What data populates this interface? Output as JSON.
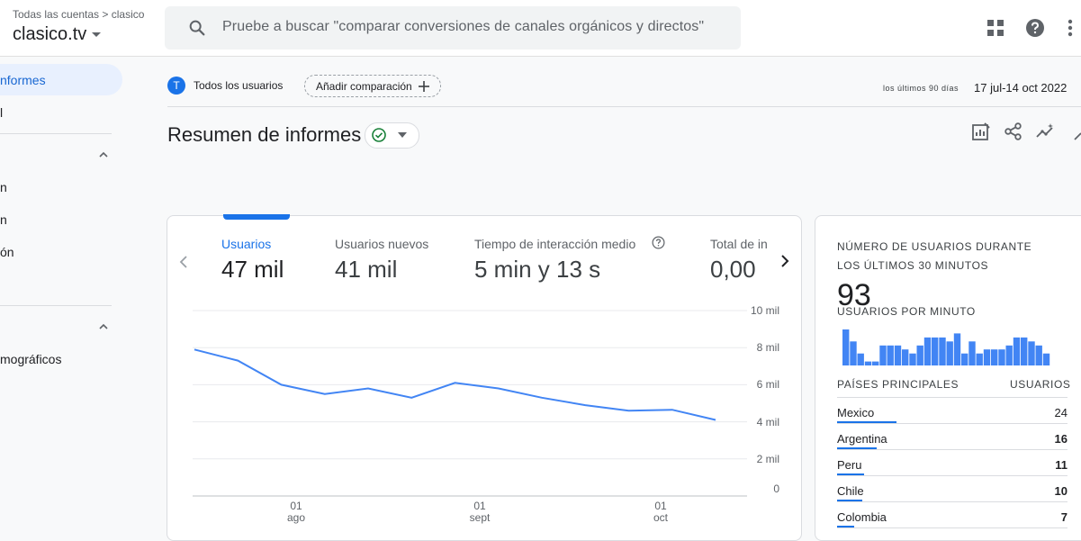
{
  "header": {
    "breadcrumb": "Todas las cuentas > clasico",
    "account": "clasico.tv",
    "search_placeholder": "Pruebe a buscar \"comparar conversiones de canales orgánicos y directos\""
  },
  "sidebar": {
    "items": [
      {
        "label": "nformes"
      },
      {
        "label": "l"
      },
      {
        "label": "n"
      },
      {
        "label": "n"
      },
      {
        "label": "ón"
      },
      {
        "label": "mográficos"
      }
    ]
  },
  "filters": {
    "user_avatar": "T",
    "user_label": "Todos los usuarios",
    "add_comparison": "Añadir comparación",
    "range_small": "los últimos 90 días",
    "range_dates": "17 jul-14 oct 2022"
  },
  "page": {
    "title": "Resumen de informes"
  },
  "metrics": [
    {
      "label": "Usuarios",
      "value": "47 mil"
    },
    {
      "label": "Usuarios nuevos",
      "value": "41 mil"
    },
    {
      "label": "Tiempo de interacción medio",
      "value": "5 min y 13 s"
    },
    {
      "label": "Total de in",
      "value": "0,00"
    }
  ],
  "chart_data": {
    "type": "line",
    "y_ticks": [
      "10 mil",
      "8 mil",
      "6 mil",
      "4 mil",
      "2 mil",
      "0"
    ],
    "x_ticks": [
      {
        "day": "01",
        "month": "ago"
      },
      {
        "day": "01",
        "month": "sept"
      },
      {
        "day": "01",
        "month": "oct"
      }
    ],
    "ylim": [
      0,
      10000
    ],
    "series": [
      {
        "values": [
          7900,
          7300,
          6000,
          5500,
          5800,
          5300,
          6100,
          5800,
          5300,
          4900,
          4600,
          4650,
          4100
        ]
      }
    ],
    "color": "#4285f4"
  },
  "realtime": {
    "heading": "NÚMERO DE USUARIOS DURANTE LOS ÚLTIMOS 30 MINUTOS",
    "count": "93",
    "per_minute_label": "USUARIOS POR MINUTO",
    "per_minute": [
      9,
      6,
      3,
      1,
      1,
      5,
      5,
      5,
      4,
      3,
      5,
      7,
      7,
      7,
      6,
      8,
      3,
      6,
      3,
      4,
      4,
      4,
      5,
      7,
      7,
      6,
      5,
      3
    ],
    "countries_label": "PAÍSES PRINCIPALES",
    "users_label": "USUARIOS",
    "countries": [
      {
        "name": "Mexico",
        "value": "24",
        "share": 1.0
      },
      {
        "name": "Argentina",
        "value": "16",
        "share": 0.67
      },
      {
        "name": "Peru",
        "value": "11",
        "share": 0.46
      },
      {
        "name": "Chile",
        "value": "10",
        "share": 0.42
      },
      {
        "name": "Colombia",
        "value": "7",
        "share": 0.29
      }
    ]
  }
}
